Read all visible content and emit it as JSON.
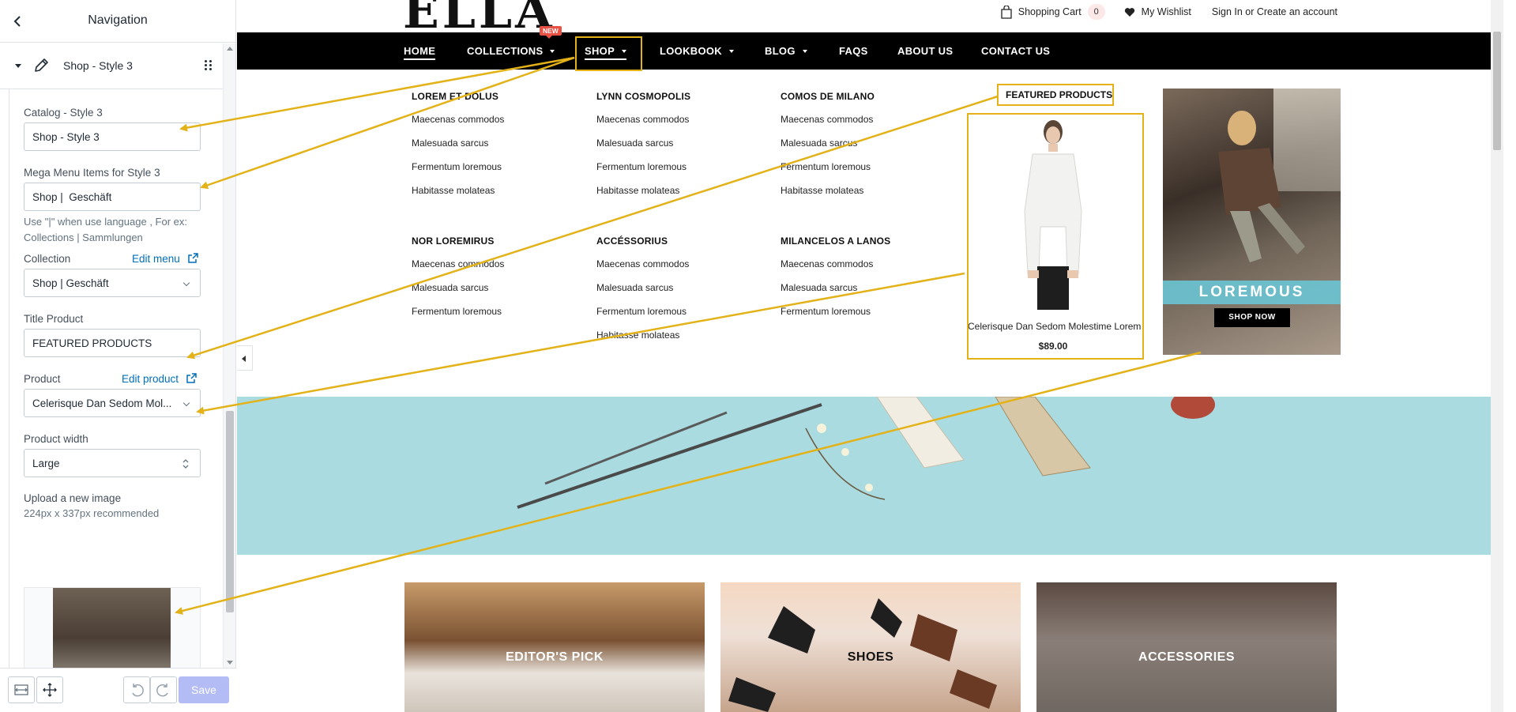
{
  "sidebar": {
    "title": "Navigation",
    "block_label": "Shop - Style 3",
    "fields": {
      "catalog_label": "Catalog - Style 3",
      "catalog_value": "Shop - Style 3",
      "mega_label": "Mega Menu Items for Style 3",
      "mega_value": "Shop |  Geschäft",
      "mega_help": "Use \"|\" when use language , For ex: Collections | Sammlungen",
      "collection_label": "Collection",
      "collection_edit": "Edit menu",
      "collection_value": "Shop | Geschäft",
      "title_product_label": "Title Product",
      "title_product_value": "FEATURED PRODUCTS",
      "product_label": "Product",
      "product_edit": "Edit product",
      "product_value": "Celerisque Dan Sedom Mol...",
      "width_label": "Product width",
      "width_value": "Large",
      "upload_label": "Upload a new image",
      "upload_help": "224px x 337px recommended"
    },
    "save_label": "Save"
  },
  "store": {
    "logo": "ELLA",
    "cart_label": "Shopping Cart",
    "cart_count": "0",
    "wishlist_label": "My Wishlist",
    "account_label": "Sign In or Create an account",
    "new_badge": "NEW",
    "nav": [
      "HOME",
      "COLLECTIONS",
      "SHOP",
      "LOOKBOOK",
      "BLOG",
      "FAQS",
      "ABOUT US",
      "CONTACT US"
    ]
  },
  "mega_menu": {
    "columns": [
      {
        "head": "LOREM ET DOLUS",
        "links": [
          "Maecenas commodos",
          "Malesuada sarcus",
          "Fermentum loremous",
          "Habitasse molateas"
        ]
      },
      {
        "head": "LYNN COSMOPOLIS",
        "links": [
          "Maecenas commodos",
          "Malesuada sarcus",
          "Fermentum loremous",
          "Habitasse molateas"
        ]
      },
      {
        "head": "COMOS DE MILANO",
        "links": [
          "Maecenas commodos",
          "Malesuada sarcus",
          "Fermentum loremous",
          "Habitasse molateas"
        ]
      },
      {
        "head": "NOR LOREMIRUS",
        "links": [
          "Maecenas commodos",
          "Malesuada sarcus",
          "Fermentum loremous"
        ]
      },
      {
        "head": "ACCÉSSORIUS",
        "links": [
          "Maecenas commodos",
          "Malesuada sarcus",
          "Fermentum loremous",
          "Habitasse molateas"
        ]
      },
      {
        "head": "MILANCELOS A LANOS",
        "links": [
          "Maecenas commodos",
          "Malesuada sarcus",
          "Fermentum loremous"
        ]
      }
    ],
    "featured_title": "FEATURED PRODUCTS",
    "featured_product_name": "Celerisque Dan Sedom Molestime Lorem",
    "featured_product_price": "$89.00",
    "promo_band": "LOREMOUS",
    "promo_button": "SHOP NOW"
  },
  "tiles": [
    "EDITOR'S PICK",
    "SHOES",
    "ACCESSORIES"
  ],
  "colors": {
    "accent": "#e3b219",
    "nav_bg": "#000000",
    "hero_bg": "#a9dbe0",
    "new_badge": "#e95144",
    "link": "#006fbb",
    "save_bg": "#b3bcf5"
  }
}
